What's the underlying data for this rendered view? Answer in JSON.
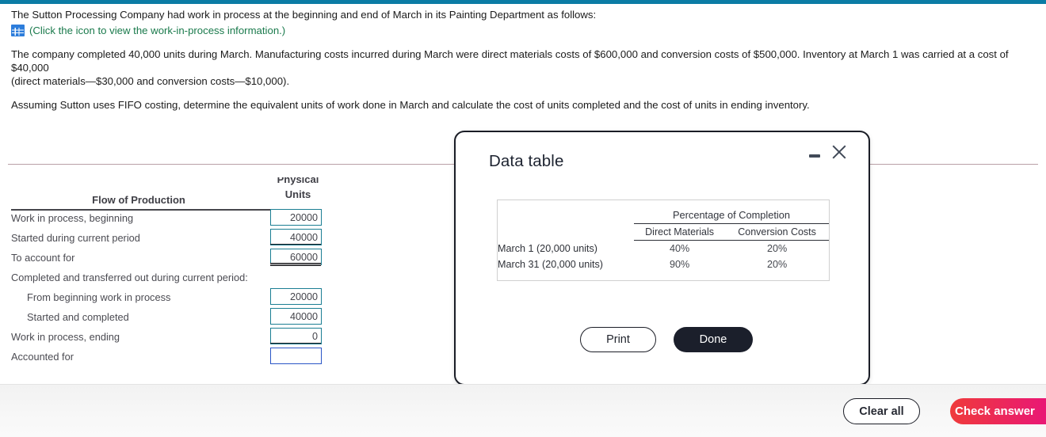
{
  "theme": {
    "accent_bar": "#0b7ca5",
    "link_green": "#1a7a4c",
    "input_border_teal": "#1b7e93",
    "input_border_focus": "#2a56c6",
    "check_answer_gradient_start": "#ef3b3b",
    "check_answer_gradient_end": "#e8127e",
    "done_button": "#1b1f2b"
  },
  "problem": {
    "line1": "The Sutton Processing Company had work in process at the beginning and end of March in its Painting Department as follows:",
    "icon_link": "(Click the icon to view the work-in-process information.)",
    "icon_name": "grid-table-icon",
    "line2": "The company completed 40,000 units during March. Manufacturing costs incurred during March were direct materials costs of $600,000 and conversion costs of $500,000. Inventory at March 1 was carried at a cost of $40,000",
    "line2b": "(direct materials—$30,000 and conversion costs—$10,000).",
    "line3": "Assuming Sutton uses FIFO costing, determine the equivalent units of work done in March and calculate the cost of units completed and the cost of units in ending inventory."
  },
  "worksheet": {
    "col_header_1": "Flow of Production",
    "col_header_2_top": "Physical",
    "col_header_2_bottom": "Units",
    "rows": [
      {
        "label": "Work in process, beginning",
        "value": "20000",
        "indent": false,
        "rule": "none",
        "focused": false
      },
      {
        "label": "Started during current period",
        "value": "40000",
        "indent": false,
        "rule": "single",
        "focused": false
      },
      {
        "label": "To account for",
        "value": "60000",
        "indent": false,
        "rule": "double",
        "focused": false
      },
      {
        "label": "Completed and transferred out during current period:",
        "value": null,
        "indent": false,
        "rule": "none",
        "focused": false
      },
      {
        "label": "From beginning work in process",
        "value": "20000",
        "indent": true,
        "rule": "none",
        "focused": false
      },
      {
        "label": "Started and completed",
        "value": "40000",
        "indent": true,
        "rule": "none",
        "focused": false
      },
      {
        "label": "Work in process, ending",
        "value": "0",
        "indent": false,
        "rule": "single",
        "focused": false
      },
      {
        "label": "Accounted for",
        "value": "",
        "indent": false,
        "rule": "none",
        "focused": true
      }
    ]
  },
  "modal": {
    "title": "Data table",
    "minimize_icon": "minimize-icon",
    "close_icon": "close-icon",
    "table": {
      "span_header": "Percentage of Completion",
      "col_blank": "",
      "col_1": "Direct Materials",
      "col_2": "Conversion Costs",
      "rows": [
        {
          "label": "March 1 (20,000 units)",
          "direct_materials": "40%",
          "conversion_costs": "20%"
        },
        {
          "label": "March 31 (20,000 units)",
          "direct_materials": "90%",
          "conversion_costs": "20%"
        }
      ]
    },
    "print_label": "Print",
    "done_label": "Done"
  },
  "footer": {
    "clear_all_label": "Clear all",
    "check_answer_label": "Check answer"
  }
}
